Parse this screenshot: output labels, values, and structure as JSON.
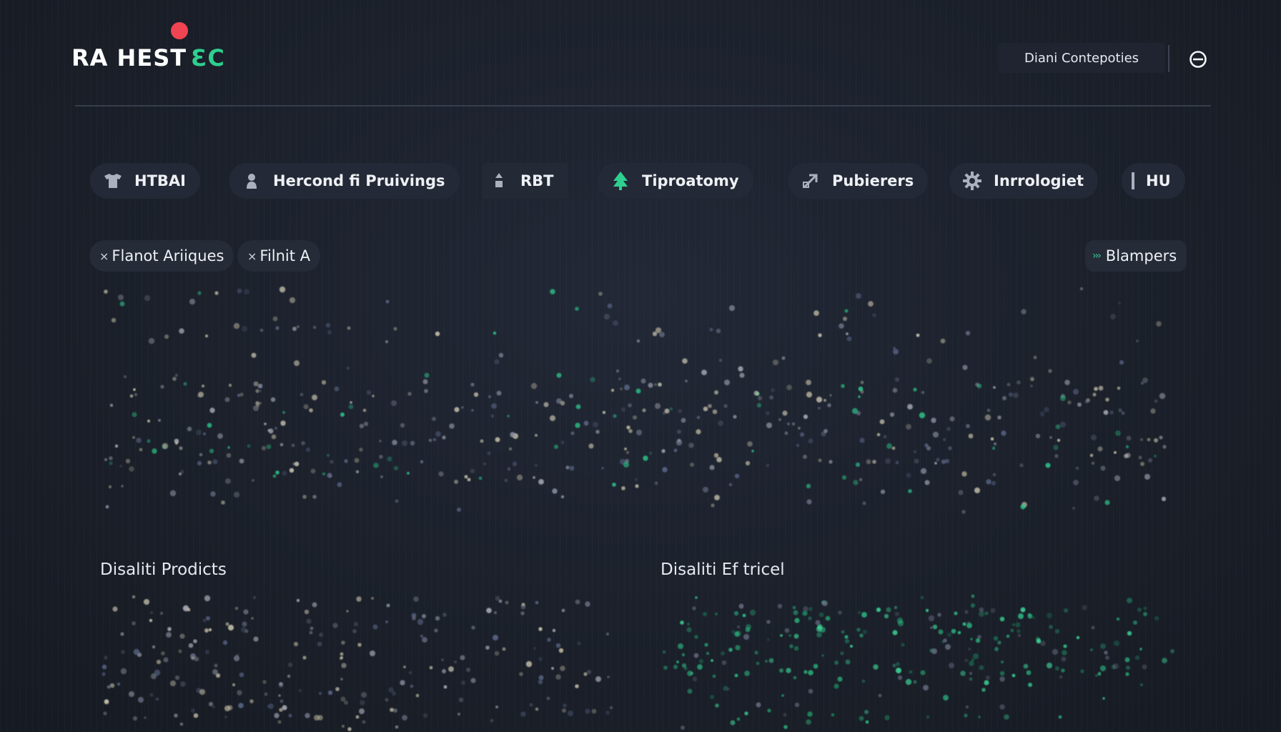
{
  "header": {
    "logo_left": "RA HEST",
    "logo_right": "ƐC",
    "account_label": "Diani Contepoties"
  },
  "tabs": [
    {
      "label": "HTBAI",
      "icon": "shirt-icon"
    },
    {
      "label": "Hercond fi Pruivings",
      "icon": "person-icon"
    },
    {
      "label": "RBT",
      "icon": "sort-icon"
    },
    {
      "label": "Tiproatomy",
      "icon": "tree-icon"
    },
    {
      "label": "Pubierers",
      "icon": "expand-arrow-icon"
    },
    {
      "label": "Inrrologiet",
      "icon": "gear-icon"
    },
    {
      "label": "HU",
      "icon": "bar-icon"
    }
  ],
  "filters": {
    "chips": [
      "Flanot Ariiques",
      "Filnit A"
    ],
    "chip_remove_symbol": "×",
    "right_button": "Blampers"
  },
  "sections": {
    "left_title": "Disaliti Prodicts",
    "right_title": "Disaliti Ef tricel"
  },
  "colors": {
    "background": "#1b202b",
    "accent_green": "#2ecf8f",
    "logo_dot_red": "#f04452",
    "tab_bg": "#232936"
  }
}
